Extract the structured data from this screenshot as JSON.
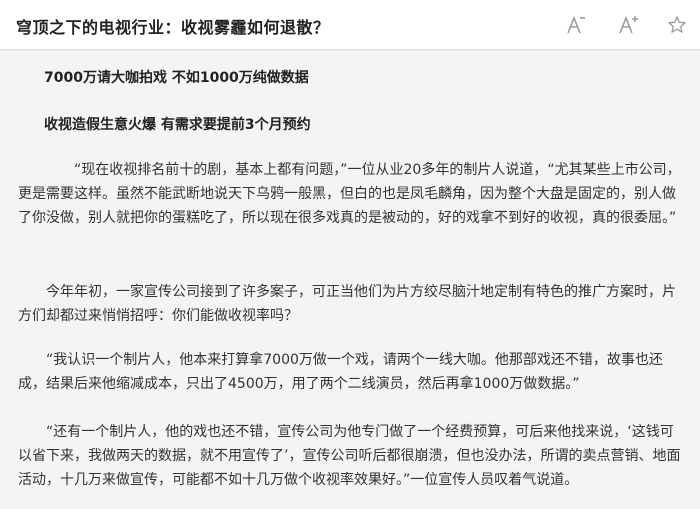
{
  "header": {
    "title": "穹顶之下的电视行业：收视雾霾如何退散？",
    "icons": [
      "font-decrease-icon",
      "font-increase-icon",
      "star-icon"
    ]
  },
  "article": {
    "subheading_1": "7000万请大咖拍戏 不如1000万纯做数据",
    "subheading_2": "收视造假生意火爆 有需求要提前3个月预约",
    "paragraphs": [
      "“现在收视排名前十的剧，基本上都有问题，”一位从业20多年的制片人说道，“尤其某些上市公司，更是需要这样。虽然不能武断地说天下乌鸦一般黑，但白的也是凤毛麟角，因为整个大盘是固定的，别人做了你没做，别人就把你的蛋糕吃了，所以现在很多戏真的是被动的，好的戏拿不到好的收视，真的很委屈。”",
      "今年年初，一家宣传公司接到了许多案子，可正当他们为片方绞尽脑汁地定制有特色的推广方案时，片方们却都过来悄悄招呼：你们能做收视率吗？",
      "“我认识一个制片人，他本来打算拿7000万做一个戏，请两个一线大咖。他那部戏还不错，故事也还成，结果后来他缩减成本，只出了4500万，用了两个二线演员，然后再拿1000万做数据。”",
      "“还有一个制片人，他的戏也还不错，宣传公司为他专门做了一个经费预算，可后来他找来说，‘这钱可以省下来，我做两天的数据，就不用宣传了’，宣传公司听后都很崩溃，但也没办法，所谓的卖点营销、地面活动，十几万来做宣传，可能都不如十几万做个收视率效果好。”一位宣传人员叹着气说道。"
    ]
  }
}
